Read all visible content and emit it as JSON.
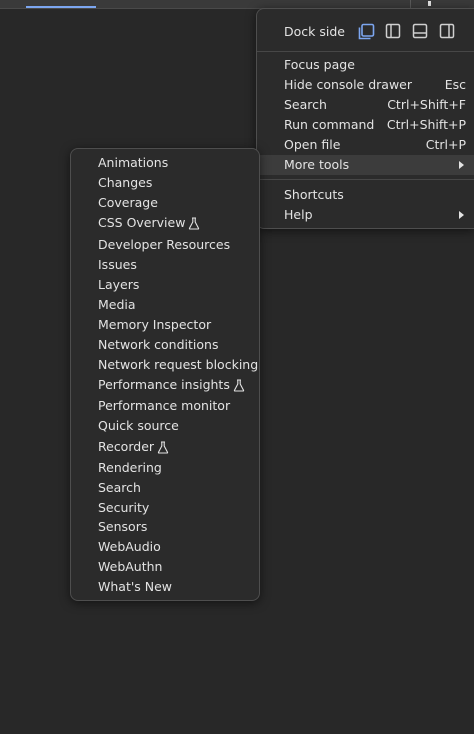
{
  "main_menu": {
    "dock_side_label": "Dock side",
    "dock_options": [
      "undock",
      "dock-left",
      "dock-bottom",
      "dock-right"
    ],
    "items": [
      {
        "label": "Focus page",
        "shortcut": ""
      },
      {
        "label": "Hide console drawer",
        "shortcut": "Esc"
      },
      {
        "label": "Search",
        "shortcut": "Ctrl+Shift+F"
      },
      {
        "label": "Run command",
        "shortcut": "Ctrl+Shift+P"
      },
      {
        "label": "Open file",
        "shortcut": "Ctrl+P"
      },
      {
        "label": "More tools",
        "shortcut": ""
      }
    ],
    "bottom_items": [
      {
        "label": "Shortcuts"
      },
      {
        "label": "Help"
      }
    ]
  },
  "more_tools_menu": {
    "items": [
      {
        "label": "Animations"
      },
      {
        "label": "Changes"
      },
      {
        "label": "Coverage"
      },
      {
        "label": "CSS Overview",
        "experimental": true
      },
      {
        "label": "Developer Resources"
      },
      {
        "label": "Issues"
      },
      {
        "label": "Layers"
      },
      {
        "label": "Media"
      },
      {
        "label": "Memory Inspector"
      },
      {
        "label": "Network conditions"
      },
      {
        "label": "Network request blocking"
      },
      {
        "label": "Performance insights",
        "experimental": true
      },
      {
        "label": "Performance monitor"
      },
      {
        "label": "Quick source"
      },
      {
        "label": "Recorder",
        "experimental": true
      },
      {
        "label": "Rendering"
      },
      {
        "label": "Search"
      },
      {
        "label": "Security"
      },
      {
        "label": "Sensors"
      },
      {
        "label": "WebAudio"
      },
      {
        "label": "WebAuthn"
      },
      {
        "label": "What's New"
      }
    ]
  },
  "colors": {
    "accent": "#7ca6f0",
    "menu_bg": "#2b2b2b",
    "page_bg": "#282828",
    "highlight": "#3c3c3c",
    "text": "#e3e3e3"
  }
}
